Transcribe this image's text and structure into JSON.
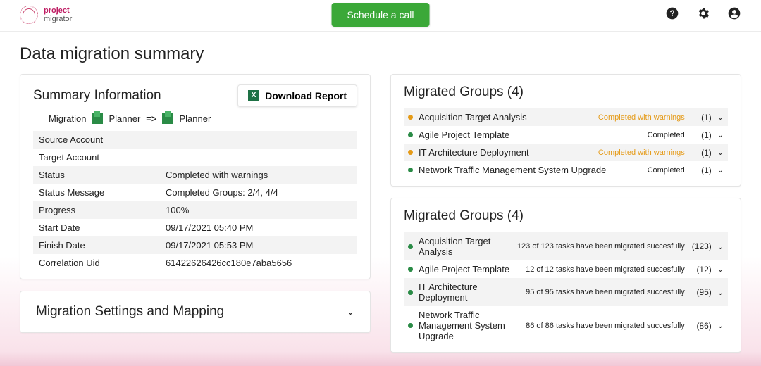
{
  "header": {
    "logo": {
      "line1": "project",
      "line2": "migrator"
    },
    "cta_label": "Schedule a call"
  },
  "page_title": "Data migration summary",
  "summary": {
    "title": "Summary Information",
    "download_label": "Download Report",
    "migration_label": "Migration",
    "source_tool": "Planner",
    "arrow": "=>",
    "target_tool": "Planner",
    "rows": [
      {
        "k": "Source Account",
        "v": ""
      },
      {
        "k": "Target Account",
        "v": ""
      },
      {
        "k": "Status",
        "v": "Completed with warnings"
      },
      {
        "k": "Status Message",
        "v": "Completed Groups: 2/4, 4/4"
      },
      {
        "k": "Progress",
        "v": "100%"
      },
      {
        "k": "Start Date",
        "v": "09/17/2021 05:40 PM"
      },
      {
        "k": "Finish Date",
        "v": "09/17/2021 05:53 PM"
      },
      {
        "k": "Correlation Uid",
        "v": "61422626426cc180e7aba5656"
      }
    ]
  },
  "settings_title": "Migration Settings and Mapping",
  "groups1": {
    "title": "Migrated Groups (4)",
    "items": [
      {
        "name": "Acquisition Target Analysis",
        "status": "Completed with warnings",
        "count": "(1)",
        "warn": true
      },
      {
        "name": "Agile Project Template",
        "status": "Completed",
        "count": "(1)",
        "warn": false
      },
      {
        "name": "IT Architecture Deployment",
        "status": "Completed with warnings",
        "count": "(1)",
        "warn": true
      },
      {
        "name": "Network Traffic Management System Upgrade",
        "status": "Completed",
        "count": "(1)",
        "warn": false
      }
    ]
  },
  "groups2": {
    "title": "Migrated Groups (4)",
    "items": [
      {
        "name": "Acquisition Target Analysis",
        "status": "123 of 123 tasks have been migrated succesfully",
        "count": "(123)"
      },
      {
        "name": "Agile Project Template",
        "status": "12 of 12 tasks have been migrated succesfully",
        "count": "(12)"
      },
      {
        "name": "IT Architecture Deployment",
        "status": "95 of 95 tasks have been migrated succesfully",
        "count": "(95)"
      },
      {
        "name": "Network Traffic Management System Upgrade",
        "status": "86 of 86 tasks have been migrated succesfully",
        "count": "(86)"
      }
    ]
  }
}
